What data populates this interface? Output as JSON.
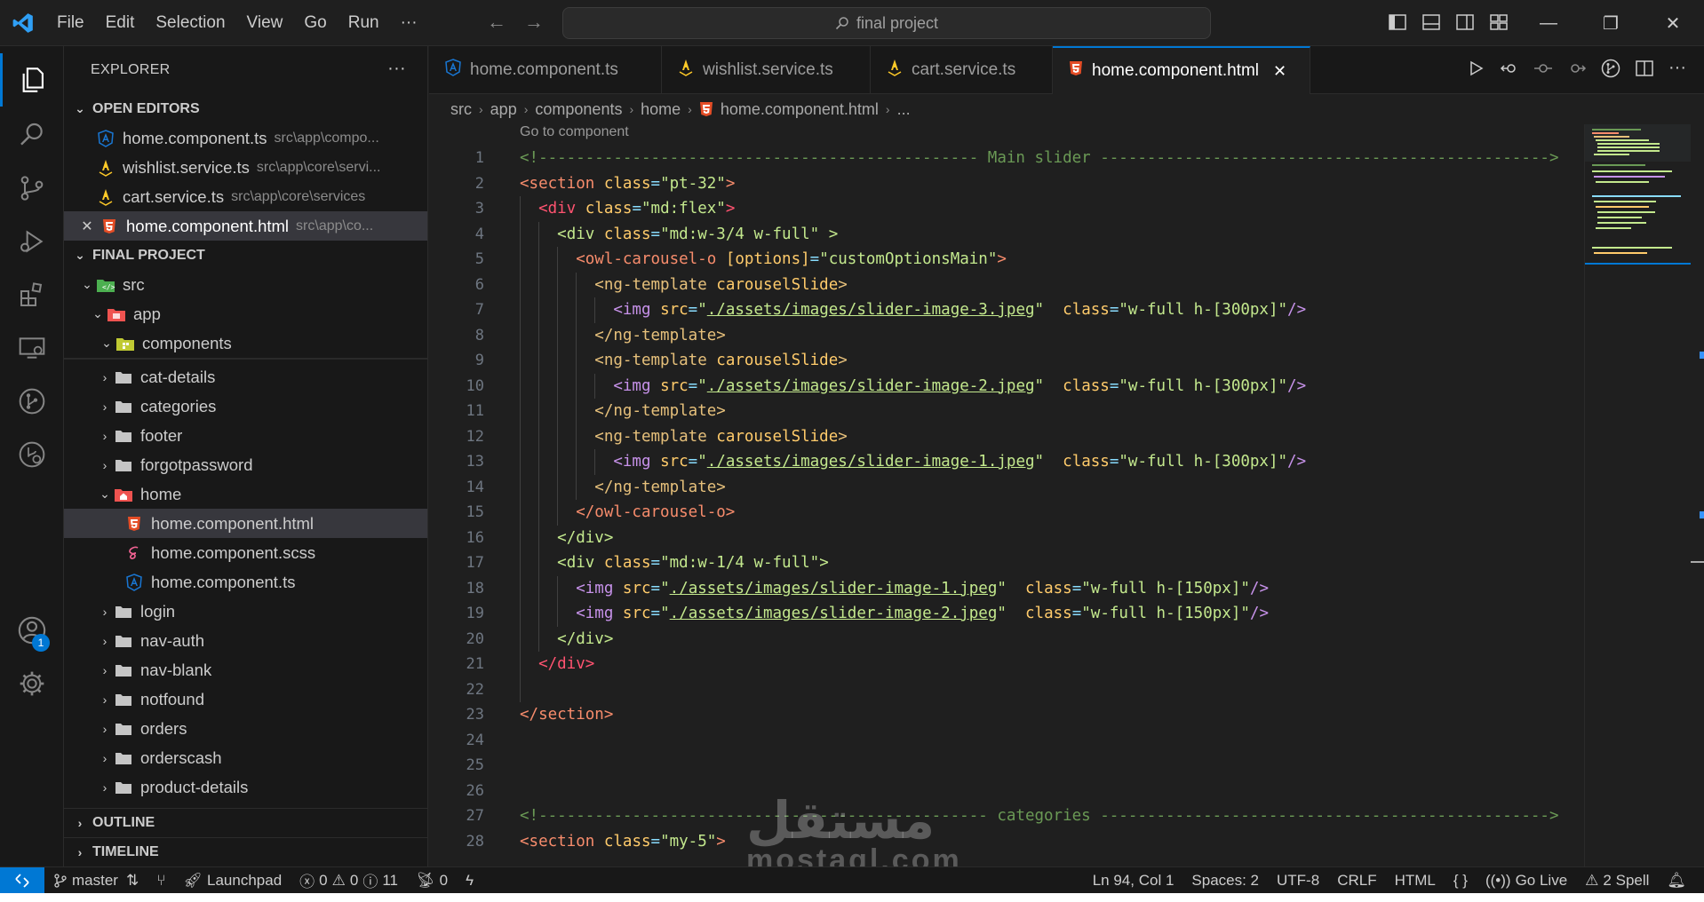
{
  "menu": [
    "File",
    "Edit",
    "Selection",
    "View",
    "Go",
    "Run",
    "···"
  ],
  "search": {
    "text": "final project"
  },
  "explorer": {
    "title": "EXPLORER",
    "more": "···",
    "open_editors_label": "OPEN EDITORS",
    "open_editors": [
      {
        "name": "home.component.ts",
        "path": "src\\app\\compo...",
        "icon": "angular-icon"
      },
      {
        "name": "wishlist.service.ts",
        "path": "src\\app\\core\\servi...",
        "icon": "angular-service-icon"
      },
      {
        "name": "cart.service.ts",
        "path": "src\\app\\core\\services",
        "icon": "angular-service-icon"
      },
      {
        "name": "home.component.html",
        "path": "src\\app\\co...",
        "icon": "html-icon",
        "close": "✕"
      }
    ],
    "project_label": "FINAL PROJECT",
    "tree": {
      "src": "src",
      "app": "app",
      "components": "components",
      "folders": [
        "cat-details",
        "categories",
        "footer",
        "forgotpassword"
      ],
      "home": "home",
      "home_files": [
        "home.component.html",
        "home.component.scss",
        "home.component.ts"
      ],
      "folders_after": [
        "login",
        "nav-auth",
        "nav-blank",
        "notfound",
        "orders",
        "orderscash",
        "product-details"
      ]
    },
    "outline_label": "OUTLINE",
    "timeline_label": "TIMELINE"
  },
  "activity": {
    "accounts_badge": "1"
  },
  "tabs": [
    {
      "label": "home.component.ts",
      "icon": "angular-icon"
    },
    {
      "label": "wishlist.service.ts",
      "icon": "angular-service-icon"
    },
    {
      "label": "cart.service.ts",
      "icon": "angular-service-icon"
    },
    {
      "label": "home.component.html",
      "icon": "html-icon",
      "active": true,
      "close": "✕"
    }
  ],
  "breadcrumb": [
    "src",
    "app",
    "components",
    "home",
    "home.component.html",
    "..."
  ],
  "editor": {
    "codelens": "Go to component",
    "line_numbers": [
      "1",
      "2",
      "3",
      "4",
      "5",
      "6",
      "7",
      "8",
      "9",
      "10",
      "11",
      "12",
      "13",
      "14",
      "15",
      "16",
      "17",
      "18",
      "19",
      "20",
      "21",
      "22",
      "23",
      "24",
      "25",
      "26",
      "27",
      "28"
    ]
  },
  "status": {
    "branch": "master",
    "launchpad": "Launchpad",
    "errors": "0",
    "warnings": "0",
    "info": "11",
    "ports": "0",
    "position": "Ln 94, Col 1",
    "spaces": "Spaces: 2",
    "encoding": "UTF-8",
    "eol": "CRLF",
    "language": "HTML",
    "golive": "Go Live",
    "spell": "2 Spell"
  },
  "watermark": {
    "arabic": "مستقل",
    "latin": "mostaql.com"
  },
  "colors": {
    "accent": "#0078d4",
    "html_icon": "#e44d26",
    "angular": "#1976d2",
    "service": "#ffca28"
  }
}
